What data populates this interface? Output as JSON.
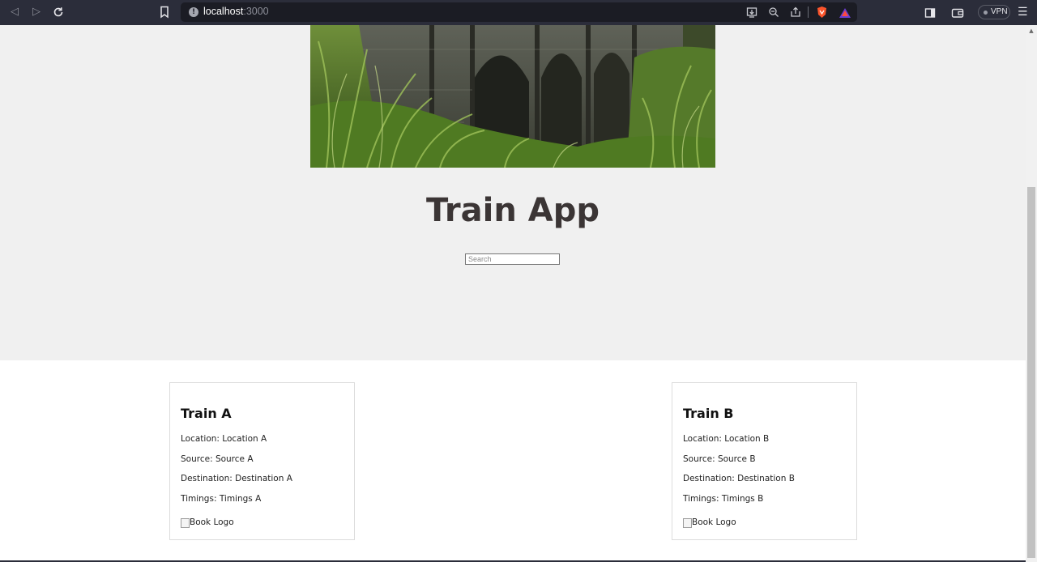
{
  "browser": {
    "url_host": "localhost",
    "url_port": ":3000",
    "vpn_label": "VPN"
  },
  "hero": {
    "title": "Train App",
    "search_placeholder": "Search"
  },
  "trains": [
    {
      "name": "Train A",
      "location": "Location: Location A",
      "source": "Source: Source A",
      "destination": "Destination: Destination A",
      "timings": "Timings: Timings A",
      "image_alt": "Book Logo"
    },
    {
      "name": "Train B",
      "location": "Location: Location B",
      "source": "Source: Source B",
      "destination": "Destination: Destination B",
      "timings": "Timings: Timings B",
      "image_alt": "Book Logo"
    }
  ],
  "colors": {
    "chrome_bg": "#2b2d3a",
    "hero_bg": "#f0f0f0",
    "title_color": "#3b3535"
  }
}
